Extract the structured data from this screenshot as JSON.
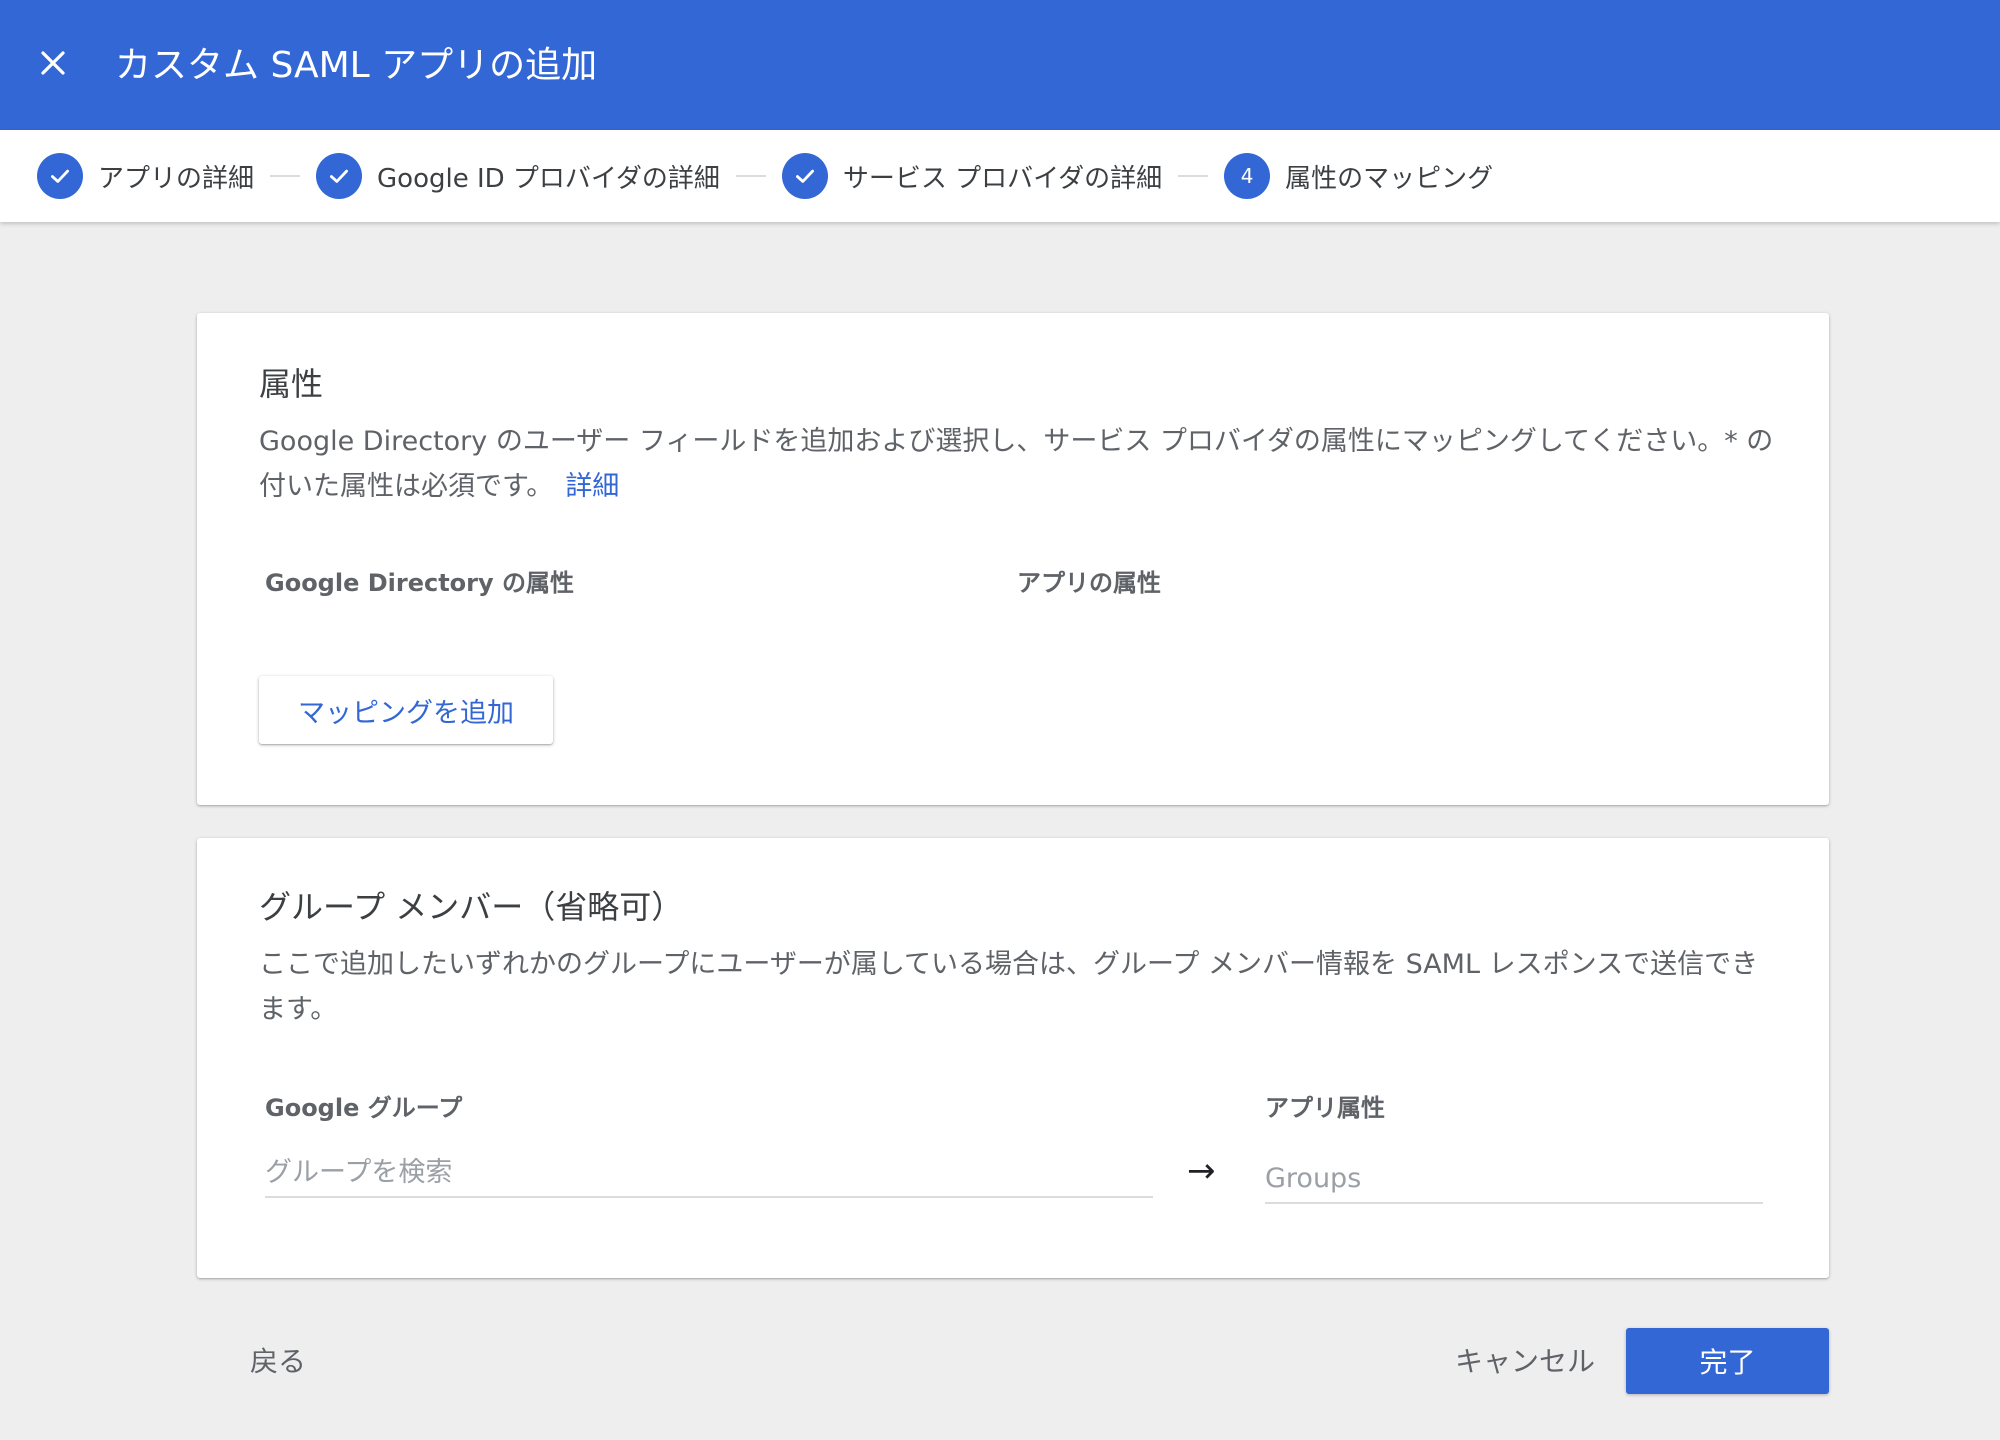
{
  "header": {
    "title": "カスタム SAML アプリの追加",
    "background": "#3367d6"
  },
  "stepper": {
    "steps": [
      {
        "label": "アプリの詳細",
        "state": "completed"
      },
      {
        "label": "Google ID プロバイダの詳細",
        "state": "completed"
      },
      {
        "label": "サービス プロバイダの詳細",
        "state": "completed"
      },
      {
        "label": "属性のマッピング",
        "state": "active",
        "number": "4"
      }
    ]
  },
  "attributes": {
    "title": "属性",
    "description": "Google Directory のユーザー フィールドを追加および選択し、サービス プロバイダの属性にマッピングしてください。* の付いた属性は必須です。",
    "link": "詳細",
    "col_directory": "Google Directory の属性",
    "col_app": "アプリの属性",
    "add_mapping_label": "マッピングを追加"
  },
  "group_members": {
    "title": "グループ メンバー（省略可）",
    "description": "ここで追加したいずれかのグループにユーザーが属している場合は、グループ メンバー情報を SAML レスポンスで送信できます。",
    "col_google_group": "Google グループ",
    "search_placeholder": "グループを検索",
    "arrow": "→",
    "col_app_attr": "アプリ属性",
    "app_attr_placeholder": "Groups"
  },
  "footer": {
    "back_label": "戻る",
    "cancel_label": "キャンセル",
    "done_label": "完了"
  },
  "colors": {
    "accent": "#3367d6",
    "page_background": "#eeeeee"
  }
}
